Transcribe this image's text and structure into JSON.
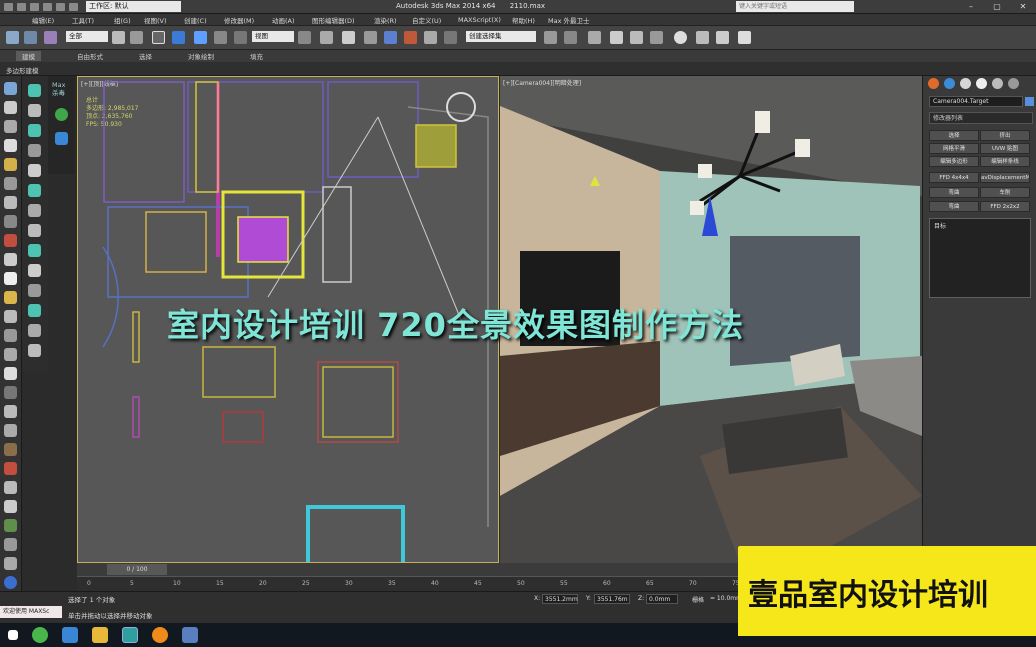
{
  "titlebar": {
    "workspace": "工作区: 默认",
    "app_title": "Autodesk 3ds Max  2014 x64",
    "file_name": "2110.max",
    "search_placeholder": "键入关键字或短语"
  },
  "menubar": {
    "items": [
      "编辑(E)",
      "工具(T)",
      "组(G)",
      "视图(V)",
      "创建(C)",
      "修改器(M)",
      "动画(A)",
      "图形编辑器(D)",
      "渲染(R)",
      "自定义(U)",
      "MAXScript(X)",
      "帮助(H)",
      "Max 外最卫士"
    ]
  },
  "toolbar": {
    "selection_filter": "全部",
    "view_dropdown": "视图",
    "selection_set": "创建选择集"
  },
  "ribbon": {
    "tabs": [
      "建模",
      "自由形式",
      "选择",
      "对象绘制",
      "填充"
    ],
    "active_panel": "多边形建模"
  },
  "left_panel": {
    "max_label": "Max\n杀毒"
  },
  "viewport_top": {
    "label": "[+][顶][线框]",
    "stats": {
      "header": "总计",
      "polys": "多边形: 2,985,017",
      "verts": "顶点:     2,635,760",
      "fps": "FPS:      50.930"
    }
  },
  "viewport_camera": {
    "label": "[+][Camera004][明暗处理]"
  },
  "command_panel": {
    "object_name": "Camera004.Target",
    "modifier_list": "修改器列表",
    "buttons": [
      [
        "选择",
        "挤出"
      ],
      [
        "网格平滑",
        "UVW 贴图"
      ],
      [
        "编辑多边形",
        "编辑样条线"
      ],
      [
        "FFD 4x4x4",
        "avDisplacementM"
      ],
      [
        "弯曲",
        "车削"
      ],
      [
        "弯曲",
        "FFD 2x2x2"
      ]
    ],
    "stack_label": "目标"
  },
  "timeline": {
    "frame": "0 / 100",
    "ticks": [
      "0",
      "5",
      "10",
      "15",
      "20",
      "25",
      "30",
      "35",
      "40",
      "45",
      "50",
      "55",
      "60",
      "65",
      "70",
      "75"
    ]
  },
  "status": {
    "welcome": "欢迎使用 MAXSc",
    "line1": "选择了 1 个对象",
    "line2": "单击并拖动以选择并移动对象",
    "x_label": "X:",
    "x_value": "3551.2mm",
    "y_label": "Y:",
    "y_value": "3551.76m",
    "z_label": "Z:",
    "z_value": "0.0mm",
    "grid_label": "栅格",
    "grid_value": "= 10.0mm"
  },
  "overlay": {
    "title": "室内设计培训 720全景效果图制作方法",
    "brand": "壹品室内设计培训"
  },
  "colors": {
    "overlay_text": "#7fe5d7",
    "brand_bg": "#f5e71a",
    "viewport_border": "#c7b25a"
  }
}
